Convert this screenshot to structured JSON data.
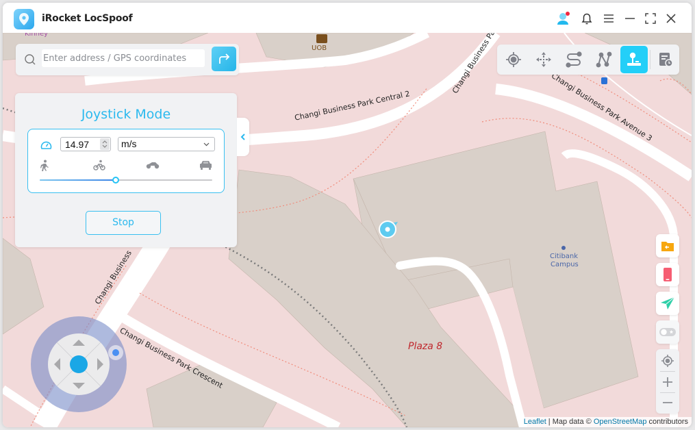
{
  "app": {
    "title": "iRocket LocSpoof"
  },
  "titlebar": {
    "icons": [
      "user-avatar-icon",
      "bell-icon",
      "menu-icon",
      "minimize-icon",
      "fullscreen-icon",
      "close-icon"
    ],
    "notification_dot_color": "#f0263f"
  },
  "search": {
    "placeholder": "Enter address / GPS coordinates",
    "value": ""
  },
  "toolbar": {
    "tools": [
      {
        "name": "teleport-mode",
        "icon": "crosshair-icon",
        "active": false
      },
      {
        "name": "jump-teleport-mode",
        "icon": "move-arrows-icon",
        "active": false
      },
      {
        "name": "two-spot-mode",
        "icon": "two-spot-route-icon",
        "active": false
      },
      {
        "name": "multi-spot-mode",
        "icon": "multi-spot-route-icon",
        "active": false
      },
      {
        "name": "joystick-mode",
        "icon": "joystick-icon",
        "active": true
      },
      {
        "name": "history",
        "icon": "history-icon",
        "active": false
      }
    ],
    "accent": "#23cff8"
  },
  "panel": {
    "title": "Joystick Mode",
    "speed_value": "14.97",
    "speed_unit": "m/s",
    "speed_modes": [
      "walk",
      "bike",
      "motorcycle",
      "car"
    ],
    "slider_fraction": 0.44,
    "stop_label": "Stop"
  },
  "side_buttons": [
    "import-gpx-icon",
    "device-icon",
    "send-location-icon",
    "toggle-icon"
  ],
  "zoom_controls": [
    "locate-me-icon",
    "zoom-in-icon",
    "zoom-out-icon"
  ],
  "map": {
    "labels": {
      "kinney": "Kinney",
      "uob": "UOB",
      "central2": "Changi Business Park Central 2",
      "business_pa": "Changi Business Pa",
      "avenue3": "Changi Business Park Avenue 3",
      "citibank": "Citibank",
      "campus": "Campus",
      "plaza8": "Plaza 8",
      "crescent": "Changi Business Park Crescent",
      "business": "Changi Business"
    }
  },
  "attribution": {
    "leaflet": "Leaflet",
    "sep": " | Map data © ",
    "osm": "OpenStreetMap",
    "contributors": " contributors"
  }
}
